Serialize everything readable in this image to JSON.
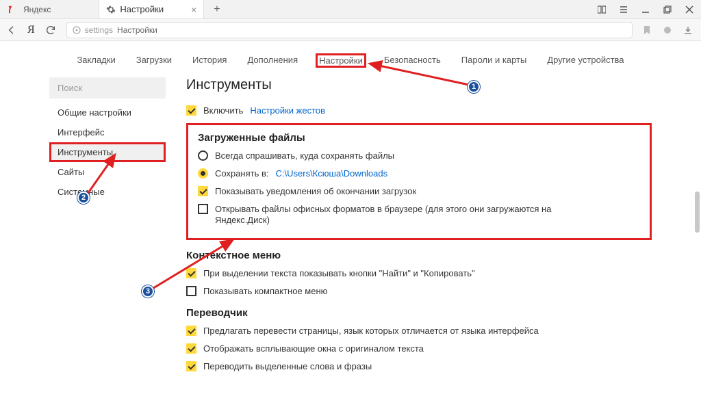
{
  "titlebar": {
    "app_name": "Яндекс",
    "tab_title": "Настройки"
  },
  "addressbar": {
    "prefix": "settings",
    "label": "Настройки"
  },
  "topnav": [
    "Закладки",
    "Загрузки",
    "История",
    "Дополнения",
    "Настройки",
    "Безопасность",
    "Пароли и карты",
    "Другие устройства"
  ],
  "topnav_active_index": 4,
  "sidebar": {
    "search_placeholder": "Поиск",
    "items": [
      "Общие настройки",
      "Интерфейс",
      "Инструменты",
      "Сайты",
      "Системные"
    ],
    "active_index": 2
  },
  "main": {
    "h1": "Инструменты",
    "enable_row": {
      "checked": true,
      "label": "Включить",
      "link": "Настройки жестов"
    },
    "downloads": {
      "heading": "Загруженные файлы",
      "radio_ask": {
        "checked": false,
        "label": "Всегда спрашивать, куда сохранять файлы"
      },
      "radio_save": {
        "checked": true,
        "label": "Сохранять в:",
        "path": "C:\\Users\\Ксюша\\Downloads"
      },
      "cb_notify": {
        "checked": true,
        "label": "Показывать уведомления об окончании загрузок"
      },
      "cb_office": {
        "checked": false,
        "label": "Открывать файлы офисных форматов в браузере (для этого они загружаются на Яндекс.Диск)"
      }
    },
    "context_menu": {
      "heading": "Контекстное меню",
      "cb_find_copy": {
        "checked": true,
        "label": "При выделении текста показывать кнопки \"Найти\" и \"Копировать\""
      },
      "cb_compact": {
        "checked": false,
        "label": "Показывать компактное меню"
      }
    },
    "translator": {
      "heading": "Переводчик",
      "cb_offer": {
        "checked": true,
        "label": "Предлагать перевести страницы, язык которых отличается от языка интерфейса"
      },
      "cb_popup": {
        "checked": true,
        "label": "Отображать всплывающие окна с оригиналом текста"
      },
      "cb_selected": {
        "checked": true,
        "label": "Переводить выделенные слова и фразы"
      }
    }
  },
  "annotations": {
    "badge1": "1",
    "badge2": "2",
    "badge3": "3"
  }
}
